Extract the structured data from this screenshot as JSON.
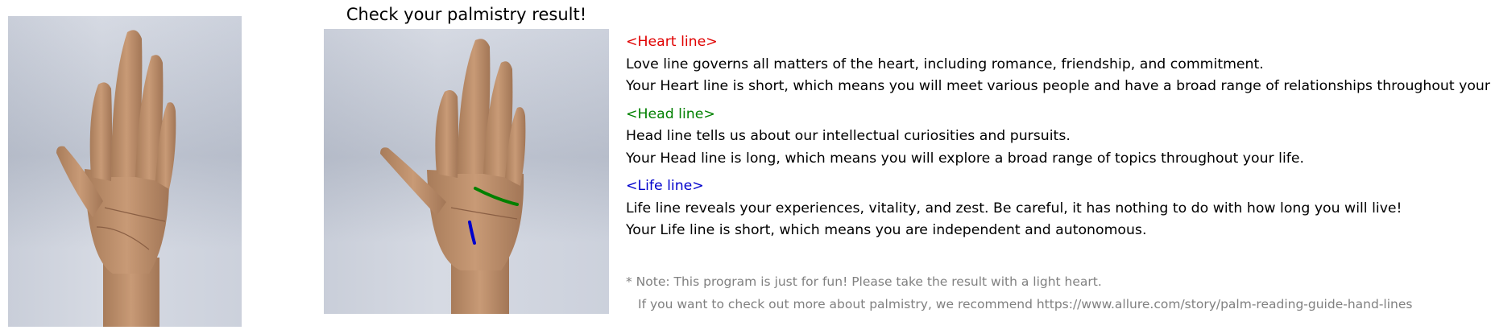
{
  "title": "Check your palmistry result!",
  "heart": {
    "header": "<Heart line>",
    "desc": "Love line governs all matters of the heart, including romance, friendship, and commitment.",
    "result": "Your Heart line is short, which means you will meet various people and have a broad range of relationships throughout your life."
  },
  "head": {
    "header": "<Head line>",
    "desc": "Head line tells us about our intellectual curiosities and pursuits.",
    "result": "Your Head line is long, which means you will explore a broad range of topics throughout your life."
  },
  "life": {
    "header": "<Life line>",
    "desc": "Life line reveals your experiences, vitality, and zest. Be careful, it has nothing to do with how long you will live!",
    "result": "Your Life line is short, which means you are independent and autonomous."
  },
  "note": {
    "line1": "* Note: This program is just for fun! Please take the result with a light heart.",
    "line2": "If you want to check out more about palmistry, we recommend https://www.allure.com/story/palm-reading-guide-hand-lines"
  },
  "colors": {
    "heart": "#e00000",
    "head": "#008000",
    "life": "#0000cc",
    "note": "#808080"
  }
}
